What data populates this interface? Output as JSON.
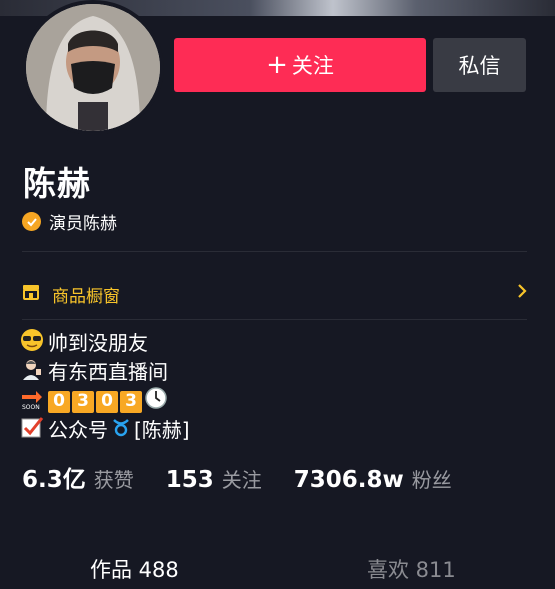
{
  "profile": {
    "name": "陈赫",
    "verification": "演员陈赫"
  },
  "actions": {
    "follow_label": "关注",
    "follow_plus": "+",
    "message_label": "私信"
  },
  "shop": {
    "label": "商品橱窗"
  },
  "bio": {
    "line1": "帅到没朋友",
    "line2": "有东西直播间",
    "line3_digits": [
      "0",
      "3",
      "0",
      "3"
    ],
    "line4_prefix": "公众号",
    "line4_suffix": "[陈赫]"
  },
  "stats": {
    "likes_value": "6.3亿",
    "likes_label": "获赞",
    "following_value": "153",
    "following_label": "关注",
    "followers_value": "7306.8w",
    "followers_label": "粉丝"
  },
  "tabs": {
    "works_label": "作品 488",
    "likes_label": "喜欢 811"
  },
  "colors": {
    "background": "#161823",
    "follow_button": "#fe2c55",
    "message_button": "#393b44",
    "shop_accent": "#f8c42a",
    "verify_badge": "#f6a623"
  }
}
